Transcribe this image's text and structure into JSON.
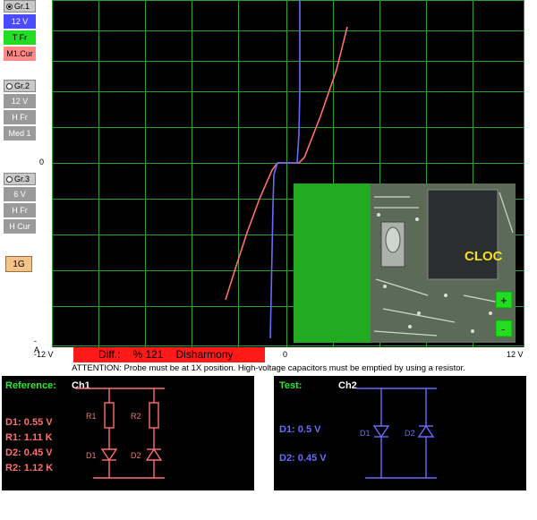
{
  "sidebar": {
    "groups": [
      {
        "radio": "Gr.1",
        "selected": true,
        "buttons": [
          "12 V",
          "T Fr",
          "M1.Cur"
        ]
      },
      {
        "radio": "Gr.2",
        "selected": false,
        "buttons": [
          "12 V",
          "H Fr",
          "Med 1"
        ]
      },
      {
        "radio": "Gr.3",
        "selected": false,
        "buttons": [
          "6 V",
          "H Fr",
          "H Cur"
        ]
      }
    ],
    "range_button": "1G"
  },
  "plot": {
    "y_zero_label": "0",
    "y_neg_label": "-A",
    "x_left_label": "-12 V",
    "x_zero_label": "0",
    "x_right_label": "12 V"
  },
  "status": {
    "diff_label": "Diff.:",
    "diff_value": "% 121",
    "diff_text": "Disharmony"
  },
  "attention": "ATTENTION: Probe must be at 1X position. High-voltage capacitors must be emptied by using a resistor.",
  "inset": {
    "chip_text": "CLOC",
    "plus": "+",
    "minus": "-"
  },
  "reference": {
    "title": "Reference:",
    "channel": "Ch1",
    "values": [
      "D1: 0.55 V",
      "R1: 1.11 K",
      "D2: 0.45 V",
      "R2: 1.12 K"
    ],
    "labels": {
      "r1": "R1",
      "r2": "R2",
      "d1": "D1",
      "d2": "D2"
    }
  },
  "test": {
    "title": "Test:",
    "channel": "Ch2",
    "values": [
      "D1: 0.5 V",
      "D2: 0.45 V"
    ],
    "labels": {
      "d1": "D1",
      "d2": "D2"
    }
  },
  "colors": {
    "grid": "#2ea02e",
    "reference": "#ff6f6f",
    "test": "#6a6aff",
    "diff_bg": "#ff1a1a",
    "panel_title": "#22ee22"
  }
}
